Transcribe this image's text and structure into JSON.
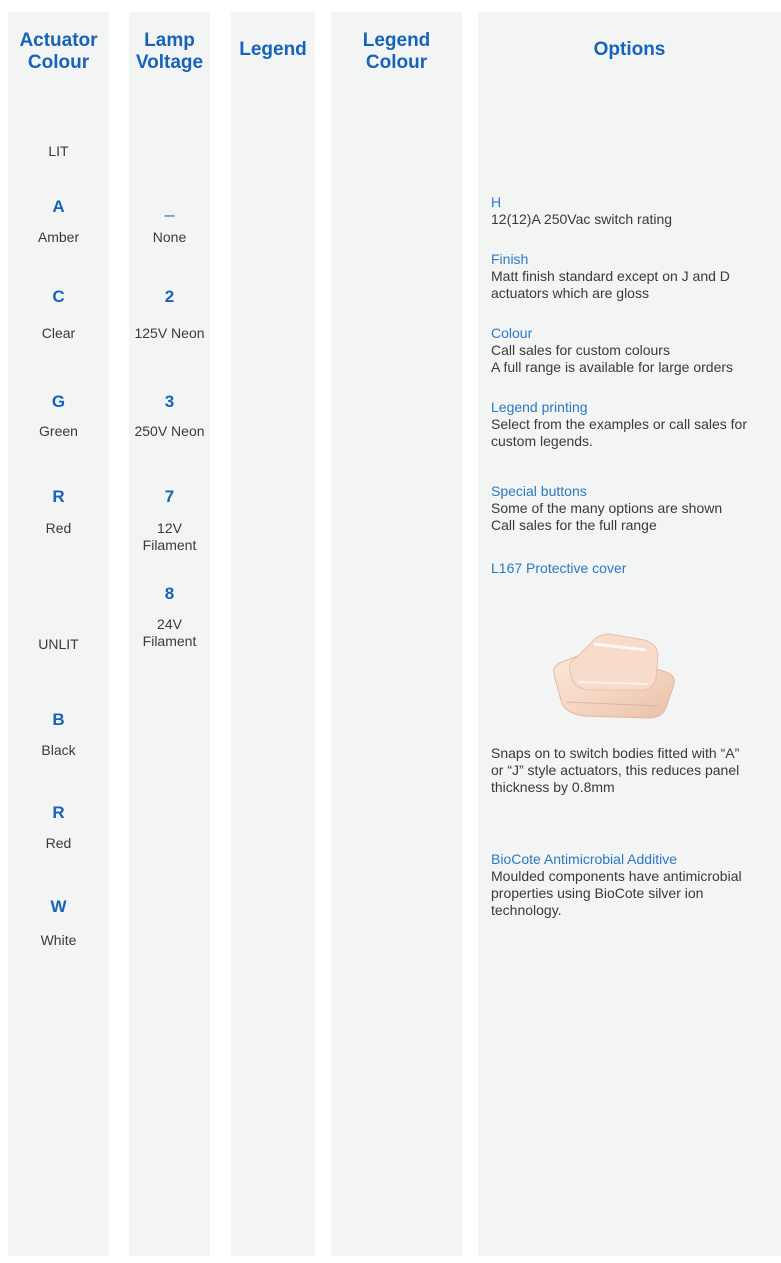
{
  "headers": {
    "actuator_colour_1": "Actuator",
    "actuator_colour_2": "Colour",
    "lamp_voltage_1": "Lamp",
    "lamp_voltage_2": "Voltage",
    "legend": "Legend",
    "legend_colour_1": "Legend",
    "legend_colour_2": "Colour",
    "options": "Options"
  },
  "actuator": {
    "lit_label": "LIT",
    "lit": [
      {
        "code": "A",
        "name": "Amber"
      },
      {
        "code": "C",
        "name": "Clear"
      },
      {
        "code": "G",
        "name": "Green"
      },
      {
        "code": "R",
        "name": "Red"
      }
    ],
    "unlit_label": "UNLIT",
    "unlit": [
      {
        "code": "B",
        "name": "Black"
      },
      {
        "code": "R",
        "name": "Red"
      },
      {
        "code": "W",
        "name": "White"
      }
    ]
  },
  "lamp": [
    {
      "code": "_",
      "name": "None"
    },
    {
      "code": "2",
      "name": "125V Neon"
    },
    {
      "code": "3",
      "name": "250V Neon"
    },
    {
      "code": "7",
      "name_1": "12V",
      "name_2": "Filament"
    },
    {
      "code": "8",
      "name_1": "24V",
      "name_2": "Filament"
    }
  ],
  "options": {
    "h": {
      "title": "H",
      "body": "12(12)A 250Vac switch rating"
    },
    "finish": {
      "title": "Finish",
      "body_1": "Matt finish standard except on J and D",
      "body_2": "actuators which are gloss"
    },
    "colour": {
      "title": "Colour",
      "body_1": "Call sales for custom colours",
      "body_2": "A full range is available for large orders"
    },
    "legend_printing": {
      "title": "Legend printing",
      "body_1": "Select from the examples or call sales for",
      "body_2": "custom legends."
    },
    "special": {
      "title": "Special buttons",
      "body_1": "Some of the many options are shown",
      "body_2": "Call sales for the full range"
    },
    "cover": {
      "title": "L167 Protective cover",
      "body_1": "Snaps on to switch bodies fitted with “A”",
      "body_2": "or “J” style actuators, this reduces panel",
      "body_3": "thickness by 0.8mm"
    },
    "biocote": {
      "title": "BioCote Antimicrobial Additive",
      "body_1": "Moulded components have antimicrobial",
      "body_2": "properties using BioCote silver ion",
      "body_3": "technology."
    }
  }
}
